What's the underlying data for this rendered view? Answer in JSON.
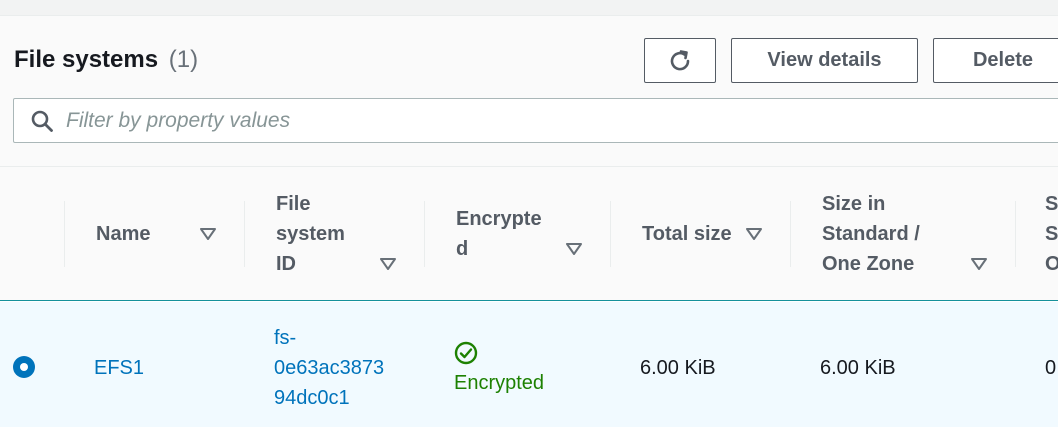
{
  "header": {
    "title": "File systems",
    "count": "(1)",
    "buttons": {
      "refresh_icon": "refresh-icon",
      "view_details": "View details",
      "delete": "Delete"
    }
  },
  "search": {
    "placeholder": "Filter by property values",
    "value": "",
    "icon": "search-icon"
  },
  "table": {
    "columns": {
      "name": [
        "Name"
      ],
      "file_system_id": [
        "File",
        "system",
        "ID"
      ],
      "encrypted": [
        "Encrypte",
        "d"
      ],
      "total_size": [
        "Total size"
      ],
      "size_standard": [
        "Size in",
        "Standard /",
        "One Zone"
      ],
      "next_col_cut": [
        "S",
        "S",
        "O"
      ]
    },
    "sort_icon": "sort-caret-down-icon",
    "rows": [
      {
        "selected": true,
        "name": "EFS1",
        "file_system_id": [
          "fs-",
          "0e63ac3873",
          "94dc0c1"
        ],
        "encrypted": "Encrypted",
        "encrypted_icon": "check-circle-icon",
        "total_size": "6.00 KiB",
        "size_standard": "6.00 KiB",
        "next_col_cut": "0"
      }
    ]
  },
  "colors": {
    "link": "#0073bb",
    "success": "#1d8102",
    "header_text": "#545b64",
    "selected_row_bg": "#f1faff",
    "selected_row_border": "#16919b"
  }
}
